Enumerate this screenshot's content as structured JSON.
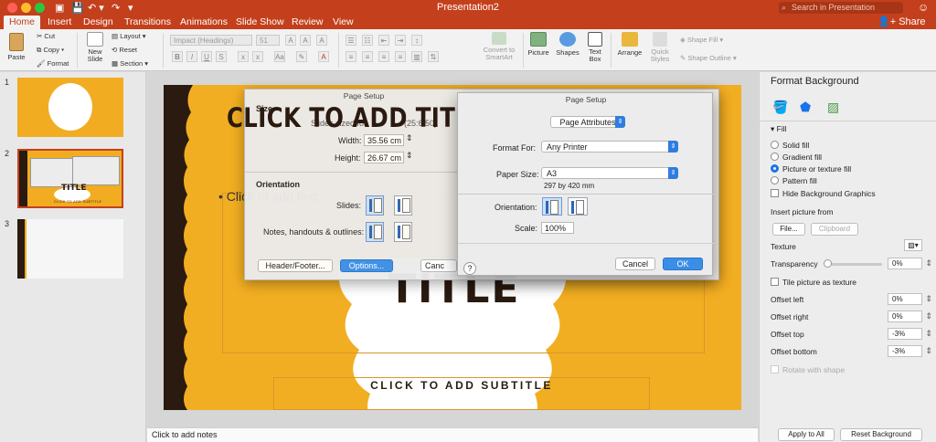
{
  "window": {
    "title": "Presentation2",
    "search_placeholder": "Search in Presentation",
    "share_label": "Share"
  },
  "tabs": [
    "Home",
    "Insert",
    "Design",
    "Transitions",
    "Animations",
    "Slide Show",
    "Review",
    "View"
  ],
  "ribbon": {
    "paste": "Paste",
    "cut": "Cut",
    "copy": "Copy",
    "format": "Format",
    "new_slide": "New\nSlide",
    "layout": "Layout",
    "reset": "Reset",
    "section": "Section",
    "font_name": "Impact (Headings)",
    "font_size": "51",
    "convert_smartart": "Convert to\nSmartArt",
    "picture": "Picture",
    "shapes": "Shapes",
    "text_box": "Text\nBox",
    "arrange": "Arrange",
    "quick_styles": "Quick\nStyles",
    "shape_fill": "Shape Fill",
    "shape_outline": "Shape Outline"
  },
  "thumbnails": [
    {
      "number": "1"
    },
    {
      "number": "2"
    },
    {
      "number": "3"
    }
  ],
  "slide": {
    "title_placeholder": "CLICK TO ADD TITLE",
    "body_placeholder": "Click to add text",
    "subtitle_placeholder": "CLICK TO ADD SUBTITLE",
    "title_fragment": "TITLE",
    "bullet": "•"
  },
  "thumb2": {
    "title_fragment": "TITLE",
    "subtitle": "CLICK TO ADD SUBTITLE"
  },
  "notes_placeholder": "Click to add notes",
  "format_background": {
    "title": "Format Background",
    "fill_section": "Fill",
    "fill_options": [
      "Solid fill",
      "Gradient fill",
      "Picture or texture fill",
      "Pattern fill"
    ],
    "selected_fill": "Picture or texture fill",
    "hide_background": "Hide Background Graphics",
    "insert_picture_from": "Insert picture from",
    "file_button": "File...",
    "clipboard_button": "Clipboard",
    "texture": "Texture",
    "transparency": "Transparency",
    "transparency_value": "0%",
    "tile_picture": "Tile picture as texture",
    "offset_left": "Offset left",
    "offset_left_value": "0%",
    "offset_right": "Offset right",
    "offset_right_value": "0%",
    "offset_top": "Offset top",
    "offset_top_value": "-3%",
    "offset_bottom": "Offset bottom",
    "offset_bottom_value": "-3%",
    "rotate_with_shape": "Rotate with shape",
    "apply_all": "Apply to All",
    "reset_background": "Reset Background"
  },
  "page_setup_back": {
    "title": "Page Setup",
    "size_label": "Size",
    "slides_sized_for": "Slides sized for",
    "size_value_fragment": "(25:6:50)",
    "width_label": "Width:",
    "width_value": "35.56 cm",
    "height_label": "Height:",
    "height_value": "26.67 cm",
    "orientation_label": "Orientation",
    "slides_label": "Slides:",
    "notes_label": "Notes, handouts & outlines:",
    "header_footer_button": "Header/Footer...",
    "options_button": "Options...",
    "cancel_fragment": "Canc"
  },
  "page_setup_front": {
    "title": "Page Setup",
    "attributes": "Page Attributes",
    "format_for_label": "Format For:",
    "format_for_value": "Any Printer",
    "paper_size_label": "Paper Size:",
    "paper_size_value": "A3",
    "paper_dims": "297 by 420 mm",
    "orientation_label": "Orientation:",
    "scale_label": "Scale:",
    "scale_value": "100%",
    "cancel_button": "Cancel",
    "ok_button": "OK"
  },
  "colors": {
    "accent": "#c4401c",
    "slide_bg": "#f2ae22",
    "slide_dark": "#2a1a10",
    "dialog_blue": "#3a8ee6"
  }
}
